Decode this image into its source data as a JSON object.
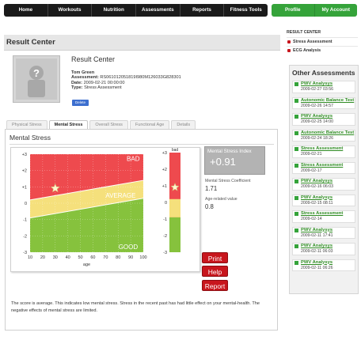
{
  "nav": {
    "items": [
      "Home",
      "Workouts",
      "Nutrition",
      "Assessments",
      "Reports",
      "Fitness Tools"
    ],
    "account_items": [
      "Profile",
      "My Account"
    ]
  },
  "page_title": "Result Center",
  "result": {
    "title": "Result Center",
    "name": "Tom Green",
    "assessment_label": "Assessment:",
    "assessment_id": "RS061012051819I980M126033G828301",
    "date_label": "Date:",
    "date": "2009-02-21 00:00:00",
    "type_label": "Type:",
    "type": "Stress Assessment",
    "delete_label": "Delete"
  },
  "tabs": [
    {
      "label": "Physical Stress",
      "active": false
    },
    {
      "label": "Mental Stress",
      "active": true
    },
    {
      "label": "Overall Stress",
      "active": false
    },
    {
      "label": "Functional Age",
      "active": false
    },
    {
      "label": "Details",
      "active": false
    }
  ],
  "panel": {
    "title": "Mental Stress",
    "index_label": "Mental Stress Index",
    "index_value": "+0.91",
    "coef_label": "Mental Stress Coefficient",
    "coef_value": "1.71",
    "age_label": "Age-related value",
    "age_value": "0.8",
    "print_label": "Print",
    "help_label": "Help",
    "report_label": "Report",
    "description": "The score is average. This indicates low mental stress. Stress in the recent past has had little effect on your mental-health. The negative effects of mental stress are limited."
  },
  "chart_data": {
    "type": "scatter",
    "xlabel": "age",
    "ylabel": "",
    "xlim": [
      10,
      100
    ],
    "ylim": [
      -3,
      3
    ],
    "x_ticks": [
      "10",
      "20",
      "30",
      "40",
      "50",
      "60",
      "70",
      "80",
      "90",
      "100"
    ],
    "y_ticks": [
      "+3",
      "+2",
      "+1",
      "0",
      "-1",
      "-2",
      "-3"
    ],
    "zones": [
      "BAD",
      "AVERAGE",
      "GOOD"
    ],
    "zone_colors": {
      "bad": "#ee4a4e",
      "average": "#f5e07c",
      "good": "#86c23d"
    },
    "point": {
      "x": 30,
      "y": 0.91
    },
    "side_bar_title": "bad",
    "side_bar_labels": [
      "+3",
      "+2",
      "+1",
      "0",
      "-1",
      "-2",
      "-3"
    ],
    "side_bar_point": 0.91
  },
  "sidebar": {
    "heading": "RESULT CENTER",
    "links": [
      "Stress Assessment",
      "ECG Analysis"
    ]
  },
  "other": {
    "heading": "Other Assessments",
    "items": [
      {
        "title": "PWV Analysys",
        "date": "2009-02-27 03:56"
      },
      {
        "title": "Autonomic Balance Test",
        "date": "2009-02-26 14:57"
      },
      {
        "title": "PWV Analysys",
        "date": "2009-02-25 14:00"
      },
      {
        "title": "Autonomic Balance Test",
        "date": "2009-02-24 18:26"
      },
      {
        "title": "Stress Assessment",
        "date": "2009-02-21"
      },
      {
        "title": "Stress Assessment",
        "date": "2009-02-17"
      },
      {
        "title": "PWV Analysys",
        "date": "2009-02-16 06:03"
      },
      {
        "title": "PWV Analysys",
        "date": "2009-02-15 08:11"
      },
      {
        "title": "Stress Assessment",
        "date": "2009-02-14"
      },
      {
        "title": "PWV Analysys",
        "date": "2009-02-11 17:41"
      },
      {
        "title": "PWV Analysys",
        "date": "2009-02-11 06:03"
      },
      {
        "title": "PWV Analysys",
        "date": "2009-02-11 06:26"
      }
    ]
  },
  "colors": {
    "brand_green": "#35a33a",
    "nav_black": "#1a1a1a",
    "button_red": "#c8161d",
    "link_green": "#2e8b22"
  }
}
